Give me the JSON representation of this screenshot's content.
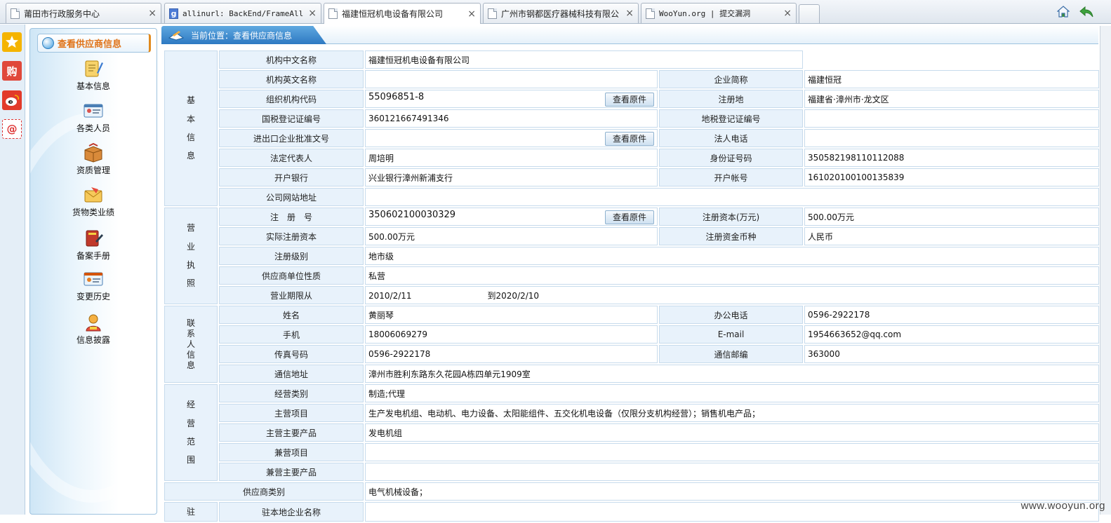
{
  "tabs": [
    {
      "label": "莆田市行政服务中心",
      "favicon": "page-icon"
    },
    {
      "label": "allinurl: BackEnd/FrameAll.a",
      "favicon": "google-icon"
    },
    {
      "label": "福建恒冠机电设备有限公司",
      "favicon": "page-icon",
      "active": true
    },
    {
      "label": "广州市钢都医疗器械科技有限公",
      "favicon": "page-icon"
    },
    {
      "label": "WooYun.org | 提交漏洞",
      "favicon": "page-icon"
    }
  ],
  "tab_close": "×",
  "google_fav": "g",
  "dock": {
    "shop": "购",
    "mail": "@"
  },
  "nav": {
    "header": "查看供应商信息",
    "items": [
      "基本信息",
      "各类人员",
      "资质管理",
      "货物类业绩",
      "备案手册",
      "变更历史",
      "信息披露"
    ]
  },
  "breadcrumb": "当前位置：查看供应商信息",
  "view_button": "查看原件",
  "sections": {
    "basic": [
      "基",
      "本",
      "信",
      "息"
    ],
    "license": [
      "营",
      "业",
      "执",
      "照"
    ],
    "contact": [
      "联",
      "系",
      "人",
      "信",
      "息"
    ],
    "scope": [
      "经",
      "营",
      "范",
      "围"
    ],
    "resident": [
      "驻"
    ]
  },
  "basic": {
    "cn_name_label": "机构中文名称",
    "cn_name": "福建恒冠机电设备有限公司",
    "en_name_label": "机构英文名称",
    "en_name": "",
    "short_label": "企业简称",
    "short": "福建恒冠",
    "org_code_label": "组织机构代码",
    "org_code": "55096851-8",
    "reg_place_label": "注册地",
    "reg_place": "福建省·漳州市·龙文区",
    "state_tax_label": "国税登记证编号",
    "state_tax": "360121667491346",
    "local_tax_label": "地税登记证编号",
    "local_tax": "",
    "import_label": "进出口企业批准文号",
    "import": "",
    "legal_phone_label": "法人电话",
    "legal_phone": "",
    "legal_rep_label": "法定代表人",
    "legal_rep": "周培明",
    "id_label": "身份证号码",
    "id": "350582198110112088",
    "bank_label": "开户银行",
    "bank": "兴业银行漳州新浦支行",
    "account_label": "开户帐号",
    "account": "161020100100135839",
    "website_label": "公司网站地址",
    "website": ""
  },
  "license": {
    "reg_no_label": "注　册　号",
    "reg_no": "350602100030329",
    "reg_capital_label": "注册资本(万元)",
    "reg_capital": "500.00万元",
    "paid_capital_label": "实际注册资本",
    "paid_capital": "500.00万元",
    "currency_label": "注册资金币种",
    "currency": "人民币",
    "level_label": "注册级别",
    "level": "地市级",
    "nature_label": "供应商单位性质",
    "nature": "私营",
    "period_label": "营业期限从",
    "period_from": "2010/2/11",
    "period_to": "到2020/2/10"
  },
  "contact": {
    "name_label": "姓名",
    "name": "黄丽琴",
    "office_label": "办公电话",
    "office": "0596-2922178",
    "mobile_label": "手机",
    "mobile": "18006069279",
    "email_label": "E-mail",
    "email": "1954663652@qq.com",
    "fax_label": "传真号码",
    "fax": "0596-2922178",
    "zip_label": "通信邮编",
    "zip": "363000",
    "address_label": "通信地址",
    "address": "漳州市胜利东路东久花园A栋四单元1909室"
  },
  "scope": {
    "type_label": "经营类别",
    "type": "制造;代理",
    "main_label": "主营项目",
    "main": "生产发电机组、电动机、电力设备、太阳能组件、五交化机电设备（仅限分支机构经营）；销售机电产品；",
    "main_prod_label": "主营主要产品",
    "main_prod": "发电机组",
    "side_label": "兼营项目",
    "side": "",
    "side_prod_label": "兼营主要产品",
    "side_prod": ""
  },
  "supplier_cat_label": "供应商类别",
  "supplier_cat": "电气机械设备；",
  "resident_name_label": "驻本地企业名称",
  "resident_name": "",
  "watermark": "www.wooyun.org",
  "colors": {
    "accent": "#2d79c2",
    "nav_header": "#e0741a",
    "label_bg": "#e8f2fb",
    "border": "#c7dbec"
  }
}
